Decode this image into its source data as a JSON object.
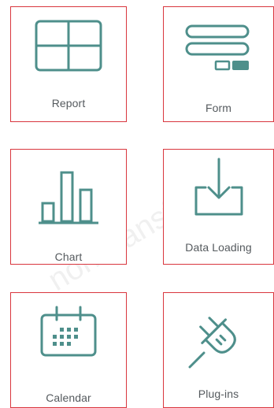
{
  "colors": {
    "tile_border": "#d9363e",
    "icon_stroke": "#4e8f8b",
    "label_text": "#555a5e"
  },
  "tiles": [
    {
      "label": "Report",
      "icon": "table-grid-icon"
    },
    {
      "label": "Form",
      "icon": "form-fields-icon"
    },
    {
      "label": "Chart",
      "icon": "bar-chart-icon"
    },
    {
      "label": "Data Loading",
      "icon": "download-tray-icon"
    },
    {
      "label": "Calendar",
      "icon": "calendar-icon"
    },
    {
      "label": "Plug-ins",
      "icon": "plug-icon"
    }
  ],
  "watermark": {
    "text": "non-transferable"
  }
}
